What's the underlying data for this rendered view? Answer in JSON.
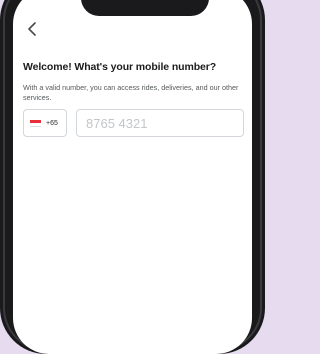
{
  "header": {
    "back_icon": "chevron-left-icon"
  },
  "main": {
    "title": "Welcome! What's your mobile number?",
    "subtitle": "With a valid number, you can access rides, deliveries, and our other services."
  },
  "phone_form": {
    "country": {
      "flag_icon": "singapore-flag-icon",
      "dial_code": "+65"
    },
    "number_input": {
      "value": "",
      "placeholder": "8765 4321"
    }
  },
  "colors": {
    "background": "#e6dbef",
    "device_frame": "#1a1a1c",
    "flag_red": "#e8303a"
  }
}
